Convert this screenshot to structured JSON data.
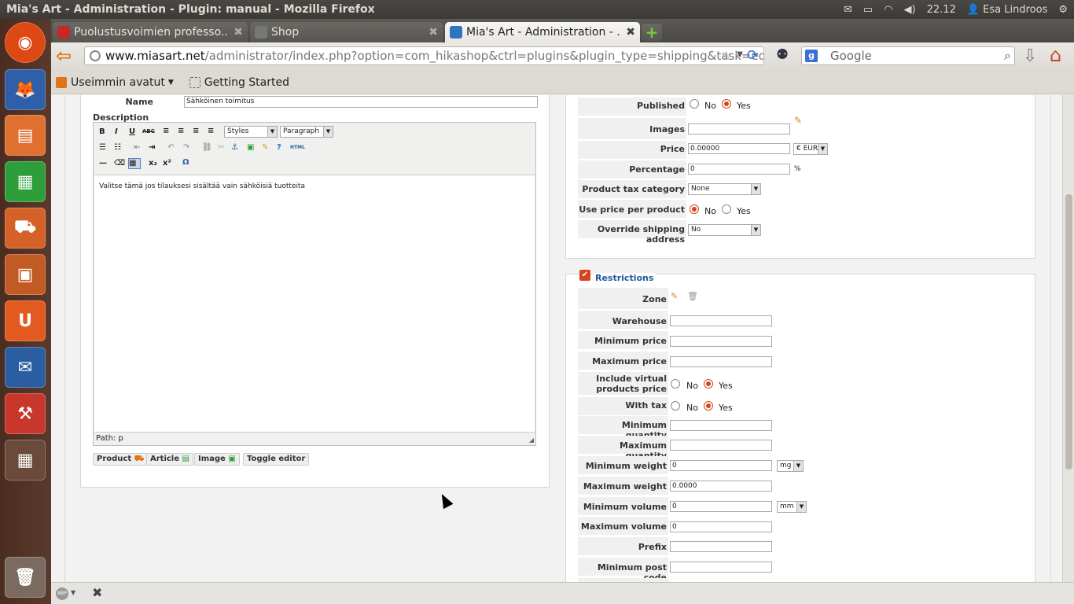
{
  "window": {
    "title": "Mia's Art - Administration - Plugin: manual - Mozilla Firefox"
  },
  "panel": {
    "clock": "22.12",
    "user": "Esa Lindroos",
    "icons": [
      "mail-icon",
      "battery-icon",
      "wifi-icon",
      "volume-icon",
      "user-icon",
      "gear-icon"
    ]
  },
  "launcher": {
    "items": [
      "ubuntu-home-icon",
      "firefox-icon",
      "files-icon",
      "libreoffice-calc-icon",
      "software-center-icon",
      "libreoffice-impress-icon",
      "ubuntu-one-icon",
      "thunderbird-icon",
      "system-settings-icon",
      "workspace-switcher-icon",
      "trash-icon"
    ]
  },
  "tabs": [
    {
      "label": "Puolustusvoimien professo...",
      "active": false
    },
    {
      "label": "Shop",
      "active": false
    },
    {
      "label": "Mia's Art - Administration - ...",
      "active": true
    }
  ],
  "nav": {
    "url_domain": "www.miasart.net",
    "url_path": "/administrator/index.php?option=com_hikashop&ctrl=plugins&plugin_type=shipping&task=edit&n",
    "search_placeholder": "Google"
  },
  "bookmarks": [
    {
      "label": "Useimmin avatut"
    },
    {
      "label": "Getting Started"
    }
  ],
  "form": {
    "name_label": "Name",
    "name_value": "Sähköinen toimitus",
    "description_label": "Description",
    "editor": {
      "styles": "Styles",
      "format": "Paragraph",
      "content": "Valitse tämä jos tilauksesi sisältää vain sähköisiä tuotteita",
      "path": "Path: p",
      "buttons": [
        "Product",
        "Article",
        "Image",
        "Toggle editor"
      ]
    }
  },
  "settings": {
    "published_label": "Published",
    "no": "No",
    "yes": "Yes",
    "images_label": "Images",
    "price_label": "Price",
    "price_value": "0.00000",
    "currency": "€ EUR",
    "percentage_label": "Percentage",
    "percentage_value": "0",
    "percent_sign": "%",
    "tax_label": "Product tax category",
    "tax_value": "None",
    "per_product_label": "Use price per product",
    "override_label": "Override shipping address",
    "override_value": "No"
  },
  "restrictions": {
    "title": "Restrictions",
    "zone": "Zone",
    "warehouse": "Warehouse",
    "min_price": "Minimum price",
    "max_price": "Maximum price",
    "include_virtual_line1": "Include virtual",
    "include_virtual_line2": "products price",
    "with_tax": "With tax",
    "min_qty": "Minimum quantity",
    "max_qty": "Maximum quantity",
    "min_weight": "Minimum weight",
    "min_weight_value": "0",
    "weight_unit": "mg",
    "max_weight": "Maximum weight",
    "max_weight_value": "0.0000",
    "min_volume": "Minimum volume",
    "min_volume_value": "0",
    "volume_unit": "mm",
    "max_volume": "Maximum volume",
    "max_volume_value": "0",
    "prefix": "Prefix",
    "min_post_code": "Minimum post code"
  },
  "colors": {
    "accent_orange": "#e0741c",
    "radio_selected": "#d3451c",
    "launcher_bg": "#4b2c20"
  }
}
